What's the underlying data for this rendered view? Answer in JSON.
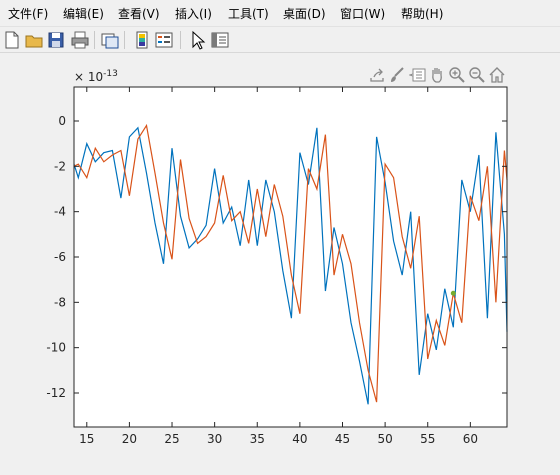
{
  "menubar": {
    "items": [
      "文件(F)",
      "编辑(E)",
      "查看(V)",
      "插入(I)",
      "工具(T)",
      "桌面(D)",
      "窗口(W)",
      "帮助(H)"
    ]
  },
  "toolbar": {
    "icons": [
      "new-figure-icon",
      "open-file-icon",
      "save-icon",
      "print-icon",
      "link-plot-icon",
      "insert-colorbar-icon",
      "insert-legend-icon",
      "pointer-icon",
      "property-inspector-icon"
    ]
  },
  "axes_toolbar": {
    "icons": [
      "export-icon",
      "brush-icon",
      "data-tips-icon",
      "pan-icon",
      "zoom-in-icon",
      "zoom-out-icon",
      "home-icon"
    ]
  },
  "chart_data": {
    "type": "line",
    "exponent_label": "× 10^-13",
    "exponent_base": "× 10",
    "exponent_power": "-13",
    "xlim": [
      13.5,
      64.3
    ],
    "ylim": [
      -13.5,
      1.5
    ],
    "x_ticks": [
      15,
      20,
      25,
      30,
      35,
      40,
      45,
      50,
      55,
      60
    ],
    "y_ticks": [
      0,
      -2,
      -4,
      -6,
      -8,
      -10,
      -12
    ],
    "x_tick_labels": [
      "15",
      "20",
      "25",
      "30",
      "35",
      "40",
      "45",
      "50",
      "55",
      "60"
    ],
    "y_tick_labels": [
      "0",
      "-2",
      "-4",
      "-6",
      "-8",
      "-10",
      "-12"
    ],
    "colors": {
      "blue": "#0072bd",
      "orange": "#d95319",
      "marker": "#77ac30"
    },
    "series": [
      {
        "color": "#0072bd",
        "x": [
          13.5,
          14,
          15,
          16,
          17,
          18,
          19,
          20,
          21,
          22,
          23,
          24,
          25,
          26,
          27,
          28,
          29,
          30,
          31,
          32,
          33,
          34,
          35,
          36,
          37,
          38,
          39,
          40,
          41,
          42,
          43,
          44,
          45,
          46,
          47,
          48,
          49,
          50,
          51,
          52,
          53,
          54,
          55,
          56,
          57,
          58,
          59,
          60,
          61,
          62,
          63,
          64,
          64.3
        ],
        "values": [
          -1.9,
          -2.5,
          -1.0,
          -1.8,
          -1.4,
          -1.3,
          -3.4,
          -0.7,
          -0.3,
          -2.3,
          -4.5,
          -6.3,
          -1.2,
          -4.2,
          -5.6,
          -5.2,
          -4.6,
          -2.1,
          -4.5,
          -3.8,
          -5.5,
          -2.6,
          -5.5,
          -2.6,
          -4.0,
          -6.6,
          -8.7,
          -1.4,
          -2.8,
          -0.3,
          -7.5,
          -4.7,
          -6.3,
          -8.9,
          -10.6,
          -12.5,
          -0.7,
          -2.7,
          -5.3,
          -6.8,
          -4.0,
          -11.2,
          -8.5,
          -10.1,
          -7.4,
          -9.1,
          -2.6,
          -4.0,
          -1.5,
          -8.7,
          -0.5,
          -5.0,
          -9.3
        ]
      },
      {
        "color": "#d95319",
        "x": [
          13.5,
          14,
          15,
          16,
          17,
          18,
          19,
          20,
          21,
          22,
          23,
          24,
          25,
          26,
          27,
          28,
          29,
          30,
          31,
          32,
          33,
          34,
          35,
          36,
          37,
          38,
          39,
          40,
          41,
          42,
          43,
          44,
          45,
          46,
          47,
          48,
          49,
          50,
          51,
          52,
          53,
          54,
          55,
          56,
          57,
          58,
          59,
          60,
          61,
          62,
          63,
          64,
          64.3
        ],
        "values": [
          -2.0,
          -1.9,
          -2.5,
          -1.2,
          -1.8,
          -1.5,
          -1.3,
          -3.3,
          -0.8,
          -0.2,
          -2.3,
          -4.5,
          -6.1,
          -1.7,
          -4.3,
          -5.4,
          -5.1,
          -4.5,
          -2.4,
          -4.4,
          -4.0,
          -5.4,
          -3.0,
          -5.1,
          -2.8,
          -4.2,
          -6.8,
          -8.5,
          -2.1,
          -3.0,
          -0.6,
          -6.8,
          -5.0,
          -6.3,
          -8.9,
          -11.0,
          -12.4,
          -1.9,
          -2.5,
          -5.1,
          -6.5,
          -4.2,
          -10.5,
          -8.8,
          -9.9,
          -7.6,
          -8.9,
          -3.3,
          -4.4,
          -2.0,
          -8.0,
          -1.3,
          -2.6
        ]
      }
    ],
    "marker_point": {
      "x": 58,
      "y": -7.6
    }
  }
}
